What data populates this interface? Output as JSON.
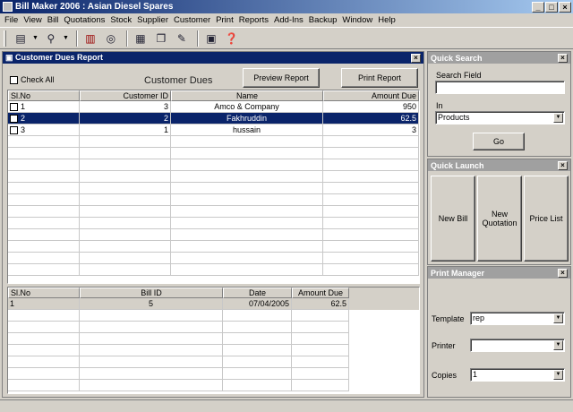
{
  "window": {
    "title": "Bill Maker 2006 : Asian Diesel Spares"
  },
  "menu": [
    "File",
    "View",
    "Bill",
    "Quotations",
    "Stock",
    "Supplier",
    "Customer",
    "Print",
    "Reports",
    "Add-Ins",
    "Backup",
    "Window",
    "Help"
  ],
  "report": {
    "title": "Customer Dues Report",
    "check_all": "Check All",
    "heading": "Customer Dues",
    "preview_btn": "Preview Report",
    "print_btn": "Print Report",
    "columns": [
      "Sl.No",
      "Customer ID",
      "Name",
      "Amount Due"
    ],
    "rows": [
      {
        "sl": "1",
        "id": "3",
        "name": "Amco & Company",
        "amount": "950"
      },
      {
        "sl": "2",
        "id": "2",
        "name": "Fakhruddin",
        "amount": "62.5"
      },
      {
        "sl": "3",
        "id": "1",
        "name": "hussain",
        "amount": "3"
      }
    ],
    "detail_columns": [
      "Sl.No",
      "Bill ID",
      "Date",
      "Amount Due"
    ],
    "detail_rows": [
      {
        "sl": "1",
        "bill": "5",
        "date": "07/04/2005",
        "amount": "62.5"
      }
    ]
  },
  "quick_search": {
    "title": "Quick Search",
    "field_label": "Search Field",
    "field_value": "",
    "in_label": "In",
    "in_value": "Products",
    "go": "Go"
  },
  "quick_launch": {
    "title": "Quick Launch",
    "new_bill": "New Bill",
    "new_quotation": "New Quotation",
    "price_list": "Price List"
  },
  "print_manager": {
    "title": "Print Manager",
    "template_label": "Template",
    "template_value": "rep",
    "printer_label": "Printer",
    "printer_value": "",
    "copies_label": "Copies",
    "copies_value": "1"
  },
  "colors": {
    "title_blue": "#0a246a",
    "face": "#d4d0c8"
  }
}
